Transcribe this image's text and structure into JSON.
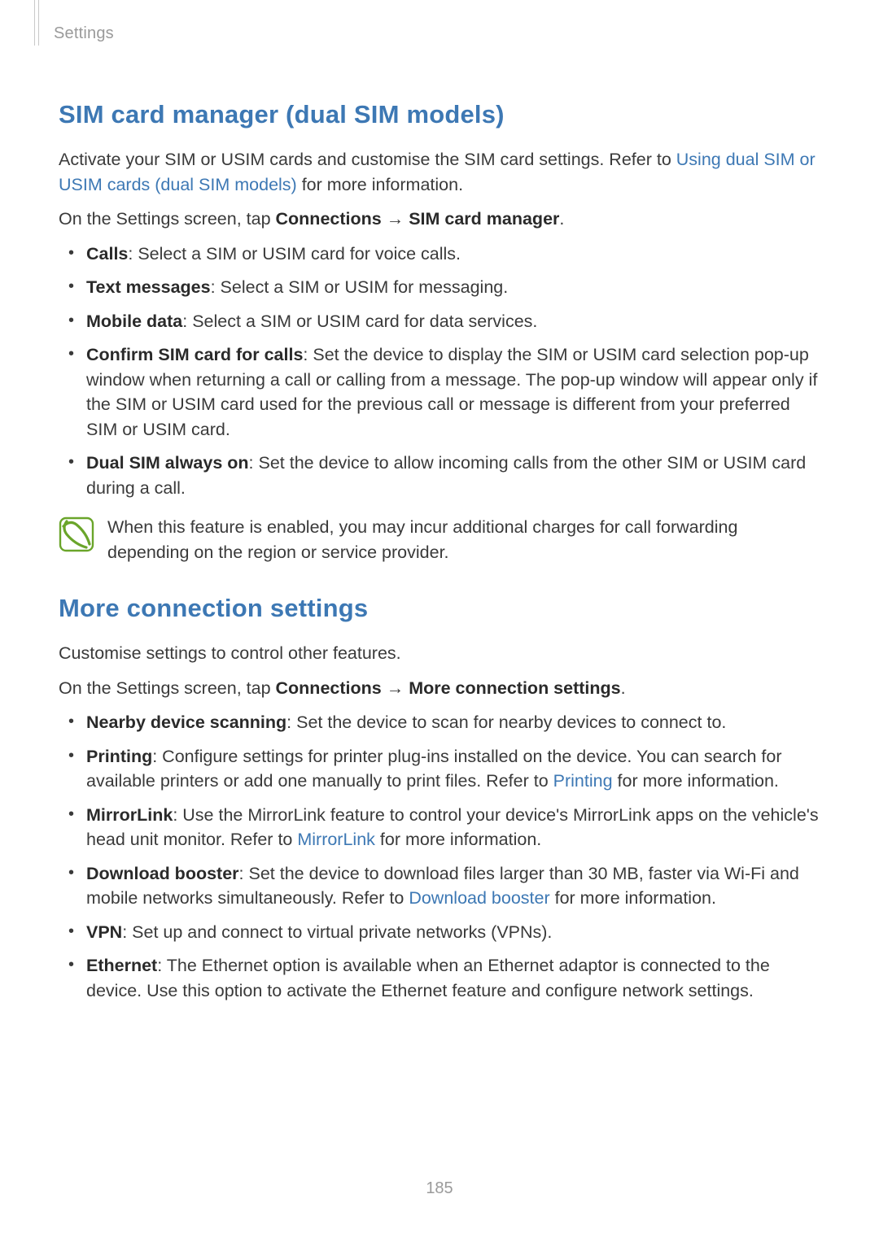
{
  "breadcrumb": "Settings",
  "page_number": "185",
  "arrow": "→",
  "section1": {
    "title": "SIM card manager (dual SIM models)",
    "intro_pre": "Activate your SIM or USIM cards and customise the SIM card settings. Refer to ",
    "intro_link": "Using dual SIM or USIM cards (dual SIM models)",
    "intro_post": " for more information.",
    "nav_pre": "On the Settings screen, tap ",
    "nav_b1": "Connections",
    "nav_b2": "SIM card manager",
    "nav_post": ".",
    "bullets": {
      "b1_bold": "Calls",
      "b1_text": ": Select a SIM or USIM card for voice calls.",
      "b2_bold": "Text messages",
      "b2_text": ": Select a SIM or USIM for messaging.",
      "b3_bold": "Mobile data",
      "b3_text": ": Select a SIM or USIM card for data services.",
      "b4_bold": "Confirm SIM card for calls",
      "b4_text": ": Set the device to display the SIM or USIM card selection pop-up window when returning a call or calling from a message. The pop-up window will appear only if the SIM or USIM card used for the previous call or message is different from your preferred SIM or USIM card.",
      "b5_bold": "Dual SIM always on",
      "b5_text": ": Set the device to allow incoming calls from the other SIM or USIM card during a call."
    },
    "note": "When this feature is enabled, you may incur additional charges for call forwarding depending on the region or service provider."
  },
  "section2": {
    "title": "More connection settings",
    "intro": "Customise settings to control other features.",
    "nav_pre": "On the Settings screen, tap ",
    "nav_b1": "Connections",
    "nav_b2": "More connection settings",
    "nav_post": ".",
    "bullets": {
      "b1_bold": "Nearby device scanning",
      "b1_text": ": Set the device to scan for nearby devices to connect to.",
      "b2_bold": "Printing",
      "b2_pre": ": Configure settings for printer plug-ins installed on the device. You can search for available printers or add one manually to print files. Refer to ",
      "b2_link": "Printing",
      "b2_post": " for more information.",
      "b3_bold": "MirrorLink",
      "b3_pre": ": Use the MirrorLink feature to control your device's MirrorLink apps on the vehicle's head unit monitor. Refer to ",
      "b3_link": "MirrorLink",
      "b3_post": " for more information.",
      "b4_bold": "Download booster",
      "b4_pre": ": Set the device to download files larger than 30 MB, faster via Wi-Fi and mobile networks simultaneously. Refer to ",
      "b4_link": "Download booster",
      "b4_post": " for more information.",
      "b5_bold": "VPN",
      "b5_text": ": Set up and connect to virtual private networks (VPNs).",
      "b6_bold": "Ethernet",
      "b6_text": ": The Ethernet option is available when an Ethernet adaptor is connected to the device. Use this option to activate the Ethernet feature and configure network settings."
    }
  }
}
